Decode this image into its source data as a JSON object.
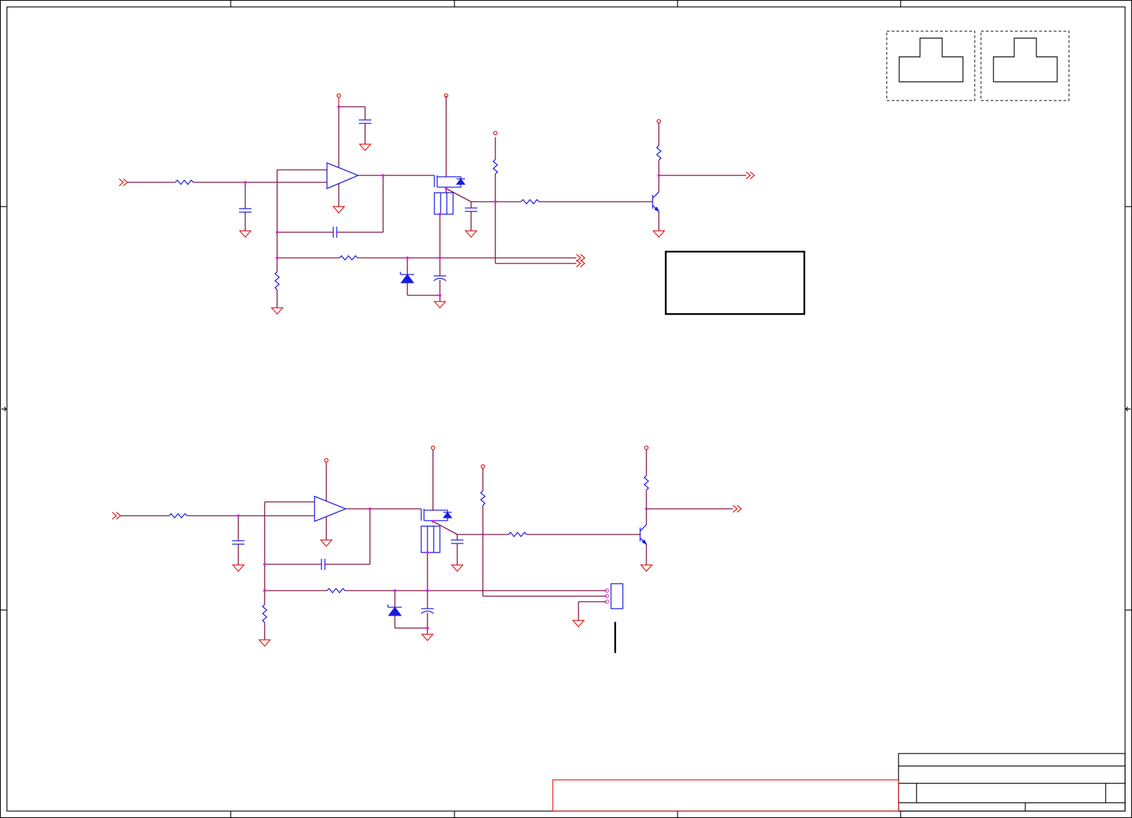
{
  "diagram": {
    "type": "electrical-schematic",
    "colors": {
      "wire": "#7a0a3c",
      "power_symbol": "#e01010",
      "component": "#1a1ae6",
      "junction": "#e020e0",
      "frame": "#000000"
    },
    "channels": [
      {
        "id": "upper",
        "components": [
          "input-port",
          "input-resistor",
          "filter-capacitor",
          "op-amp",
          "decoupling-capacitor",
          "feedback-capacitor",
          "mosfet",
          "shunt-resistor",
          "zener-diode",
          "capacitor",
          "npn-transistor",
          "pull-up-resistor",
          "base-resistor",
          "output-port",
          "feedback-port"
        ]
      },
      {
        "id": "lower",
        "components": [
          "input-port",
          "input-resistor",
          "filter-capacitor",
          "op-amp",
          "feedback-capacitor",
          "mosfet",
          "shunt-resistor",
          "zener-diode",
          "capacitor",
          "npn-transistor",
          "pull-up-resistor",
          "base-resistor",
          "output-port",
          "connector-3pin"
        ]
      }
    ],
    "title_block": {
      "rows": 3
    }
  }
}
